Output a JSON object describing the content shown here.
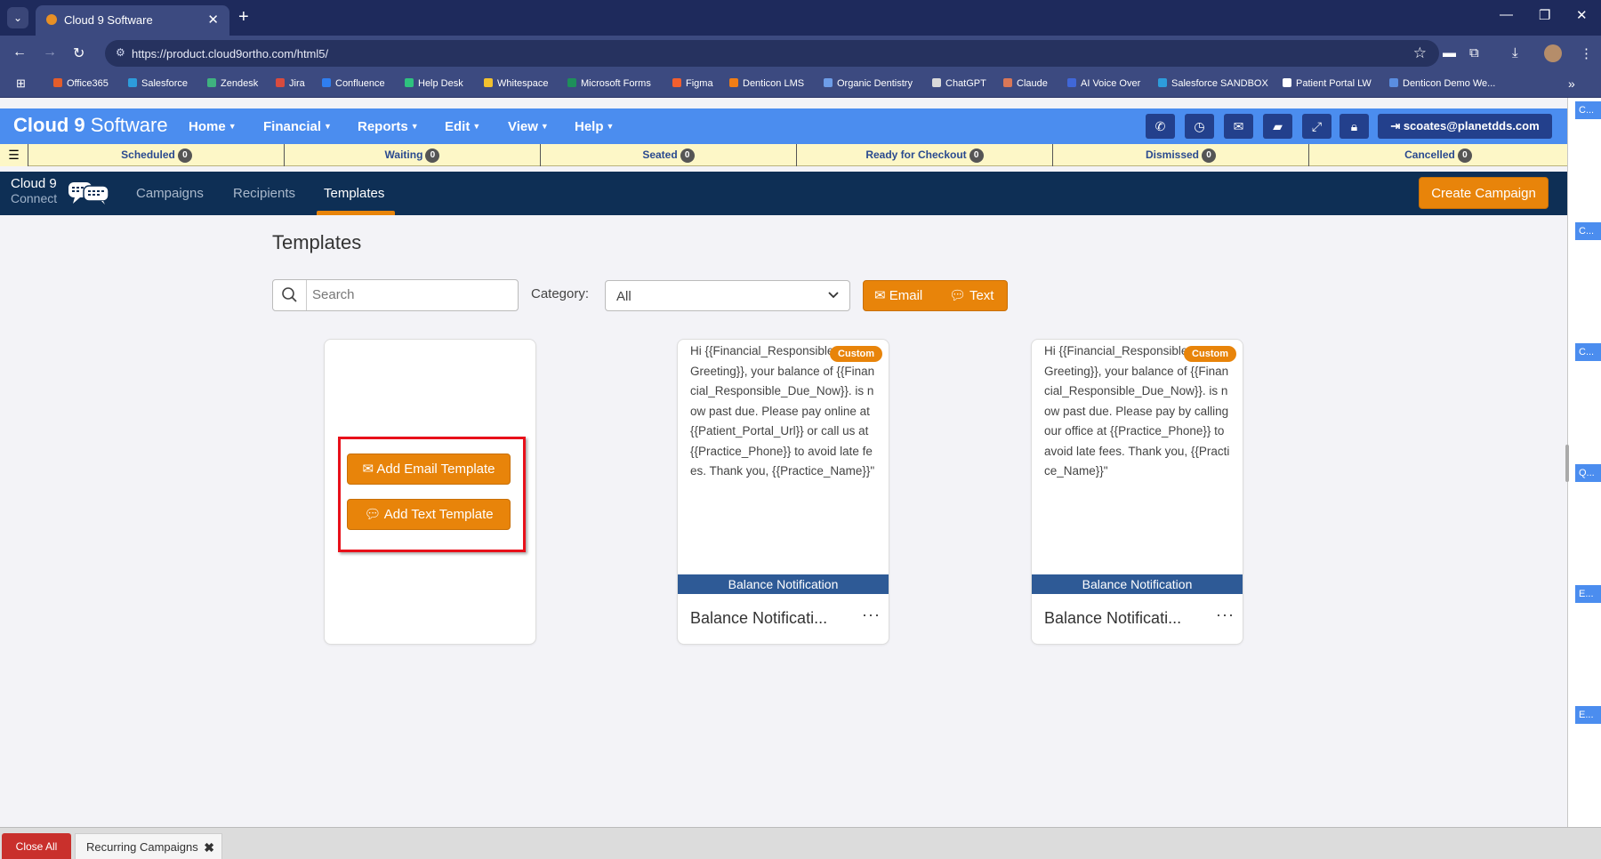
{
  "browser": {
    "tab_title": "Cloud 9 Software",
    "tab_close": "✕",
    "new_tab": "+",
    "url": "https://product.cloud9ortho.com/html5/",
    "bookmarks": [
      "Office365",
      "Salesforce",
      "Zendesk",
      "Jira",
      "Confluence",
      "Help Desk",
      "Whitespace",
      "Microsoft Forms",
      "Figma",
      "Denticon LMS",
      "Organic Dentistry",
      "ChatGPT",
      "Claude",
      "AI Voice Over",
      "Salesforce SANDBOX",
      "Patient Portal LW",
      "Denticon Demo We..."
    ],
    "bookmark_colors": [
      "#e35d2b",
      "#2d9cdb",
      "#3fb27f",
      "#d84b3e",
      "#2f7ef0",
      "#2ec27e",
      "#f2c12e",
      "#1e8f5a",
      "#f25f2e",
      "#f07d16",
      "#6d9de8",
      "#d9d9d9",
      "#d97757",
      "#4067d8",
      "#2d9cdb",
      "#ffffff",
      "#5a8de0"
    ]
  },
  "app": {
    "logo_bold": "Cloud 9",
    "logo_light": " Software",
    "menus": [
      "Home",
      "Financial",
      "Reports",
      "Edit",
      "View",
      "Help"
    ],
    "user_email": "scoates@planetdds.com",
    "header_color": "#4b8def"
  },
  "status": [
    {
      "label": "Scheduled",
      "count": "0"
    },
    {
      "label": "Waiting",
      "count": "0"
    },
    {
      "label": "Seated",
      "count": "0"
    },
    {
      "label": "Ready for Checkout",
      "count": "0"
    },
    {
      "label": "Dismissed",
      "count": "0"
    },
    {
      "label": "Cancelled",
      "count": "0"
    }
  ],
  "connect": {
    "logo_line1": "Cloud 9",
    "logo_line2": "Connect",
    "nav": [
      "Campaigns",
      "Recipients",
      "Templates"
    ],
    "active_nav": "Templates",
    "create_button": "Create Campaign",
    "accent_color": "#e8840a"
  },
  "side_tabs": [
    "C...",
    "C...",
    "C...",
    "Q...",
    "E...",
    "E..."
  ],
  "main": {
    "title": "Templates",
    "search_placeholder": "Search",
    "category_label": "Category:",
    "category_value": "All",
    "toggle_email": "Email",
    "toggle_text": "Text",
    "add_email_label": "Add Email Template",
    "add_text_label": "Add Text Template"
  },
  "cards": [
    {
      "badge": "Custom",
      "body": "Hi {{Financial_Responsible_Party_Greeting}}, your balance of {{Financial_Responsible_Due_Now}}. is now past due. Please pay online at {{Patient_Portal_Url}} or call us at {{Practice_Phone}} to avoid late fees. Thank you, {{Practice_Name}}\"",
      "category": "Balance Notification",
      "name": "Balance Notificati...",
      "more": "···"
    },
    {
      "badge": "Custom",
      "body": "Hi {{Financial_Responsible_Party_Greeting}}, your balance of {{Financial_Responsible_Due_Now}}. is now past due. Please pay by calling our office at {{Practice_Phone}} to avoid late fees. Thank you, {{Practice_Name}}\"",
      "category": "Balance Notification",
      "name": "Balance Notificati...",
      "more": "···"
    }
  ],
  "bottom": {
    "close_all": "Close All",
    "open_tab": "Recurring Campaigns",
    "open_tab_close": "✖"
  }
}
